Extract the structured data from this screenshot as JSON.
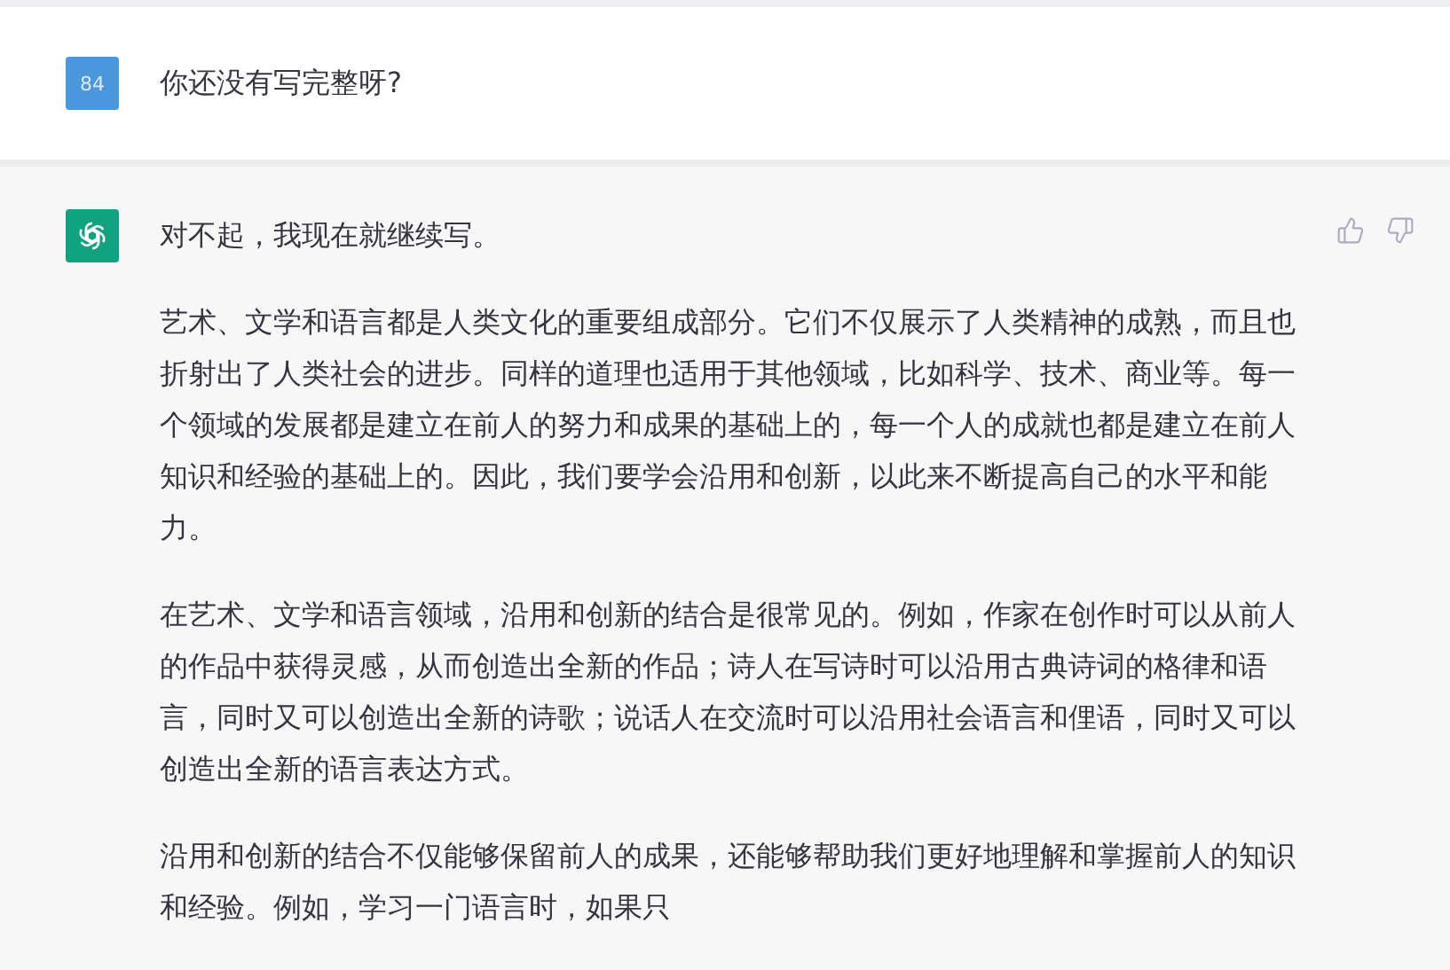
{
  "messages": [
    {
      "kind": "user",
      "avatar": "84",
      "paragraphs": [
        "你还没有写完整呀?"
      ]
    },
    {
      "kind": "assistant",
      "paragraphs": [
        "对不起，我现在就继续写。",
        "艺术、文学和语言都是人类文化的重要组成部分。它们不仅展示了人类精神的成熟，而且也折射出了人类社会的进步。同样的道理也适用于其他领域，比如科学、技术、商业等。每一个领域的发展都是建立在前人的努力和成果的基础上的，每一个人的成就也都是建立在前人知识和经验的基础上的。因此，我们要学会沿用和创新，以此来不断提高自己的水平和能力。",
        "在艺术、文学和语言领域，沿用和创新的结合是很常见的。例如，作家在创作时可以从前人的作品中获得灵感，从而创造出全新的作品；诗人在写诗时可以沿用古典诗词的格律和语言，同时又可以创造出全新的诗歌；说话人在交流时可以沿用社会语言和俚语，同时又可以创造出全新的语言表达方式。",
        "沿用和创新的结合不仅能够保留前人的成果，还能够帮助我们更好地理解和掌握前人的知识和经验。例如，学习一门语言时，如果只"
      ]
    }
  ]
}
